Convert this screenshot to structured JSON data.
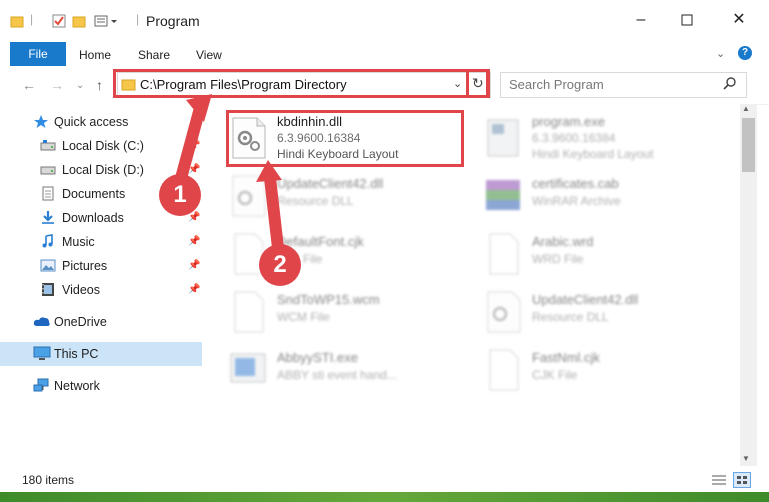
{
  "window": {
    "title": "Program"
  },
  "ribbon": {
    "tabs": [
      "File",
      "Home",
      "Share",
      "View"
    ]
  },
  "address": {
    "path": "C:\\Program Files\\Program Directory"
  },
  "search": {
    "placeholder": "Search Program"
  },
  "sidebar": {
    "items": [
      {
        "label": "Quick access",
        "icon": "star-icon"
      },
      {
        "label": "Local Disk (C:)",
        "icon": "drive-icon"
      },
      {
        "label": "Local Disk (D:)",
        "icon": "drive-icon"
      },
      {
        "label": "Documents",
        "icon": "documents-icon"
      },
      {
        "label": "Downloads",
        "icon": "download-icon"
      },
      {
        "label": "Music",
        "icon": "music-icon"
      },
      {
        "label": "Pictures",
        "icon": "pictures-icon"
      },
      {
        "label": "Videos",
        "icon": "videos-icon"
      },
      {
        "label": "OneDrive",
        "icon": "cloud-icon"
      },
      {
        "label": "This PC",
        "icon": "computer-icon"
      },
      {
        "label": "Network",
        "icon": "network-icon"
      }
    ]
  },
  "files": [
    {
      "name": "kbdinhin.dll",
      "version": "6.3.9600.16384",
      "description": "Hindi Keyboard Layout"
    },
    {
      "name": "program.exe",
      "version": "6.3.9600.16384",
      "description": "Hindi Keyboard Layout"
    },
    {
      "name": "UpdateClient42.dll",
      "type": "Resource DLL"
    },
    {
      "name": "certificates.cab",
      "type": "WinRAR Archive"
    },
    {
      "name": "DefaultFont.cjk",
      "type": "CJK File"
    },
    {
      "name": "Arabic.wrd",
      "type": "WRD File"
    },
    {
      "name": "SndToWP15.wcm",
      "type": "WCM File"
    },
    {
      "name": "UpdateClient42.dll",
      "type": "Resource DLL"
    },
    {
      "name": "AbbyySTI.exe",
      "type": "ABBY sti event hand..."
    },
    {
      "name": "FastNml.cjk",
      "type": "CJK File"
    }
  ],
  "status": {
    "count": "180 items"
  },
  "steps": {
    "one": "1",
    "two": "2"
  },
  "colors": {
    "accent": "#1979ca",
    "highlight": "#e0454a",
    "selected": "#cce4f7"
  }
}
